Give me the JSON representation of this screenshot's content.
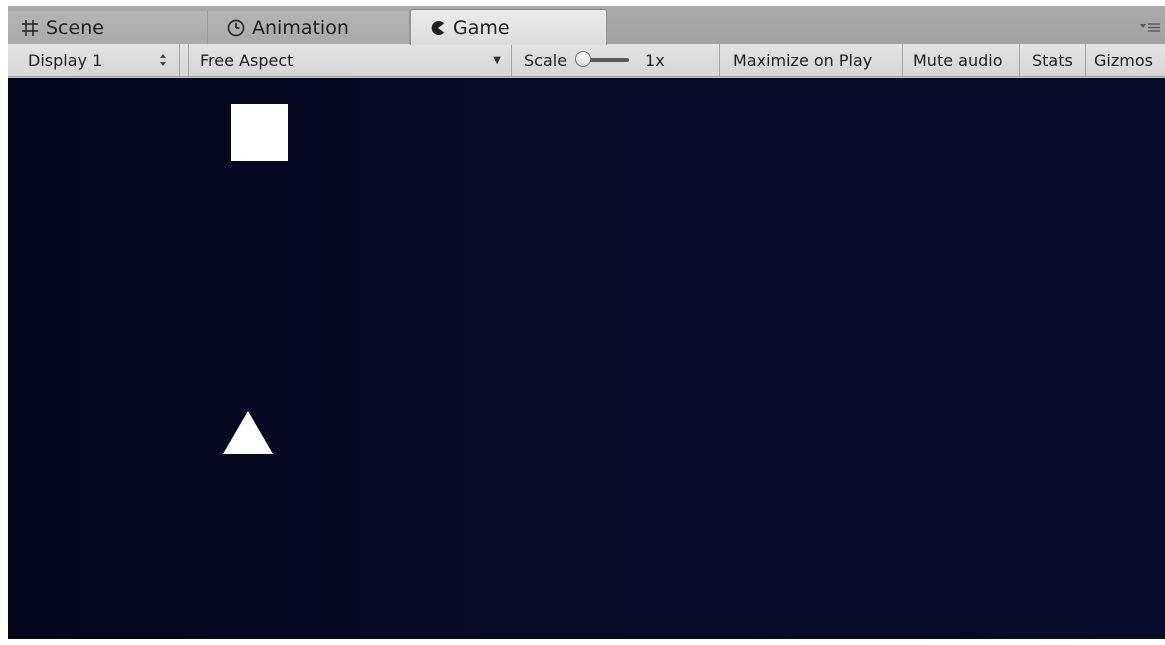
{
  "tabs": [
    {
      "label": "Scene",
      "icon": "grid-icon",
      "active": false
    },
    {
      "label": "Animation",
      "icon": "clock-icon",
      "active": false
    },
    {
      "label": "Game",
      "icon": "pacman-icon",
      "active": true
    }
  ],
  "toolbar": {
    "display_select": "Display 1",
    "aspect_select": "Free Aspect",
    "scale_label": "Scale",
    "scale_value": "1x",
    "maximize_label": "Maximize on Play",
    "mute_label": "Mute audio",
    "stats_label": "Stats",
    "gizmos_label": "Gizmos"
  },
  "game": {
    "background_color": "#060a25",
    "sprites": [
      {
        "name": "square",
        "color": "#ffffff"
      },
      {
        "name": "triangle",
        "color": "#ffffff"
      }
    ]
  },
  "colors": {
    "tabbar": "#a8a8a8",
    "active_tab": "#e6e6e6",
    "toolbar": "#dddddd"
  }
}
